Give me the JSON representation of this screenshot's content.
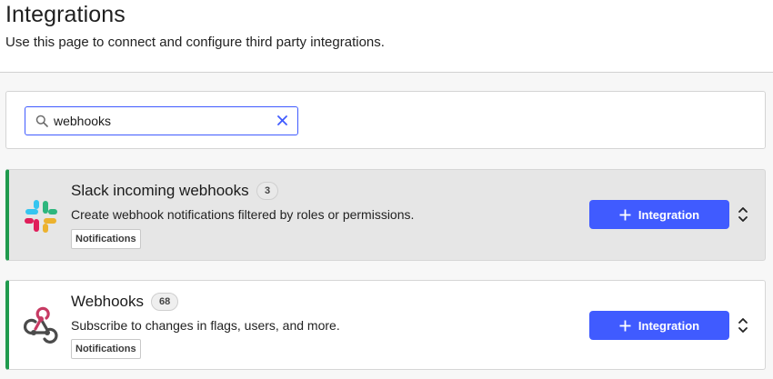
{
  "header": {
    "title": "Integrations",
    "subtitle": "Use this page to connect and configure third party integrations."
  },
  "search": {
    "value": "webhooks",
    "accent_color": "#405bff"
  },
  "integrations": [
    {
      "title": "Slack incoming webhooks",
      "count": "3",
      "description": "Create webhook notifications filtered by roles or permissions.",
      "tag": "Notifications",
      "button_label": "Integration",
      "logo": "slack-logo-icon"
    },
    {
      "title": "Webhooks",
      "count": "68",
      "description": "Subscribe to changes in flags, users, and more.",
      "tag": "Notifications",
      "button_label": "Integration",
      "logo": "webhooks-logo-icon"
    }
  ],
  "colors": {
    "primary_button": "#405bff",
    "card_accent": "#1f9a4d"
  }
}
